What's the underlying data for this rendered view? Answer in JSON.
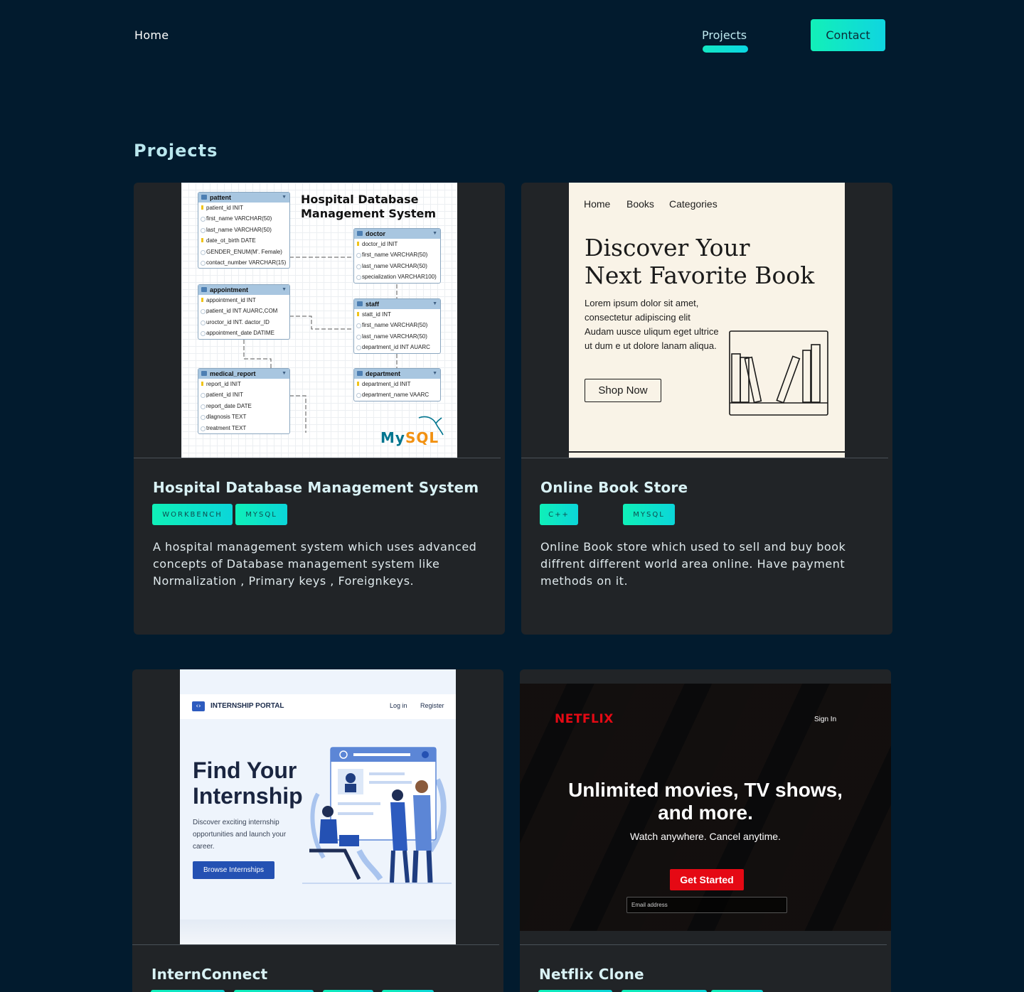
{
  "nav": {
    "home": "Home",
    "projects": "Projects",
    "contact": "Contact"
  },
  "section_title": "Projects",
  "projects": [
    {
      "title": "Hospital  Database Management System",
      "tags": [
        "WORKBENCH",
        "MYSQL"
      ],
      "description": "A hospital management system which uses advanced concepts of Database management system like Normalization , Primary keys , Foreignkeys."
    },
    {
      "title": "Online Book Store",
      "tags": [
        "C++",
        "MYSQL"
      ],
      "description": "Online Book store which used to sell and buy book diffrent different world area online. Have payment methods on it."
    },
    {
      "title": "InternConnect",
      "tags": [],
      "description": ""
    },
    {
      "title": "Netflix Clone",
      "tags": [],
      "description": ""
    }
  ],
  "er_diagram": {
    "title_line1": "Hospital Database",
    "title_line2": "Management System",
    "logo": "MySQL",
    "tables": [
      {
        "name": "pattent",
        "rows": [
          "patient_id INIT",
          "first_name VARCHAR(50)",
          "last_name VARCHAR(50)",
          "date_ot_birth DATE",
          "GENDER_ENUM(M'. Female)",
          "contact_number VARCHAR(15)"
        ]
      },
      {
        "name": "doctor",
        "rows": [
          "doctor_id INIT",
          "first_name VARCHAR(50)",
          "last_name VARCHAR(50)",
          "specialization VARCHAR100)"
        ]
      },
      {
        "name": "appointment",
        "rows": [
          "appointment_id INT",
          "patient_id INT  AUARC,COM",
          "uroctor_id INT.  dactor_ID",
          "appointment_date DATIME"
        ]
      },
      {
        "name": "staff",
        "rows": [
          "statt_id INT",
          "first_name VARCHAR(50)",
          "last_name VARCHAR(50)",
          "department_id INT  AUARC"
        ]
      },
      {
        "name": "medical_report",
        "rows": [
          "report_id INIT",
          "patient_id INIT",
          "report_date DATE",
          "dlagnosis TEXT",
          "treatment TEXT"
        ]
      },
      {
        "name": "department",
        "rows": [
          "department_id INIT",
          "department_name VAARC"
        ]
      }
    ]
  },
  "bookstore_preview": {
    "nav": [
      "Home",
      "Books",
      "Categories"
    ],
    "headline_line1": "Discover Your",
    "headline_line2": "Next Favorite Book",
    "body": "Lorem ipsum dolor sit amet, consectetur adipiscing elit Audam uusce uliqum eget ultrice ut dum e ut dolore lanam aliqua.",
    "button": "Shop Now"
  },
  "intern_preview": {
    "brand": "INTERNSHIP PORTAL",
    "login": "Log in",
    "register": "Register",
    "headline_line1": "Find Your",
    "headline_line2": "Internship",
    "sub": "Discover exciting internship opportunities and launch your career.",
    "button": "Browse Internships"
  },
  "netflix_preview": {
    "logo": "NETFLIX",
    "sign_in": "Sign In",
    "headline_line1": "Unlimited movies, TV shows,",
    "headline_line2": "and more.",
    "sub": "Watch anywhere. Cancel anytime.",
    "button": "Get Started",
    "email_placeholder": "Email address"
  },
  "colors": {
    "background": "#021b2e",
    "card": "#212427",
    "accent_start": "#12f0b8",
    "accent_end": "#0fd5e0"
  }
}
